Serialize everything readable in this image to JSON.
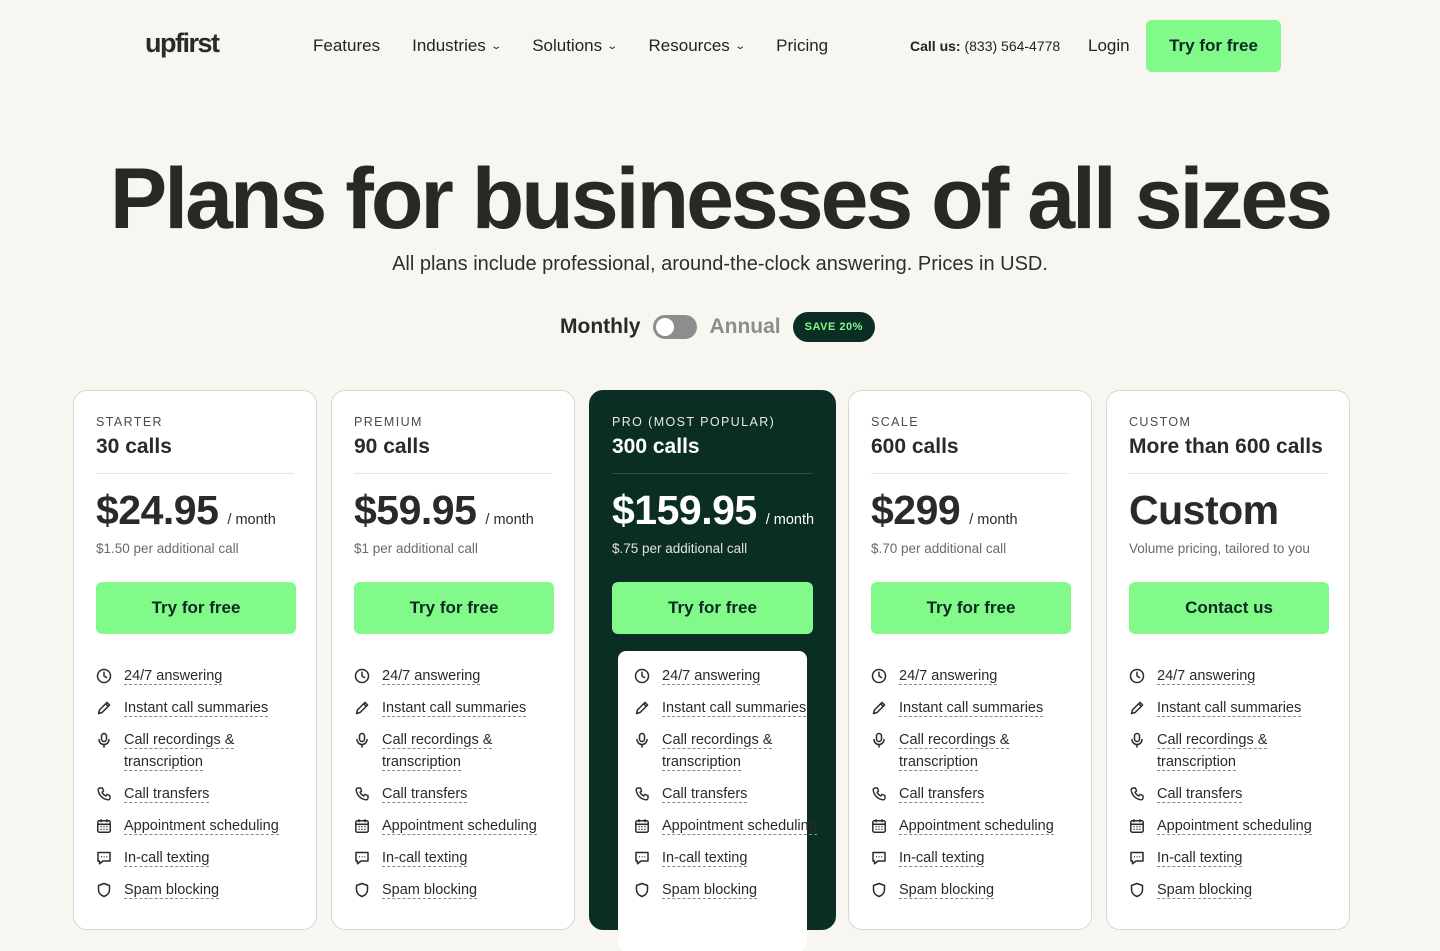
{
  "nav": {
    "logo": "upfirst",
    "menu": [
      {
        "label": "Features",
        "dropdown": false
      },
      {
        "label": "Industries",
        "dropdown": true
      },
      {
        "label": "Solutions",
        "dropdown": true
      },
      {
        "label": "Resources",
        "dropdown": true
      },
      {
        "label": "Pricing",
        "dropdown": false
      }
    ],
    "call_label": "Call us:",
    "phone": "(833) 564-4778",
    "login": "Login",
    "cta": "Try for free"
  },
  "hero": {
    "title": "Plans for businesses of all sizes",
    "subtitle": "All plans include professional, around-the-clock answering. Prices in USD."
  },
  "billing": {
    "monthly": "Monthly",
    "annual": "Annual",
    "badge": "SAVE 20%"
  },
  "colors": {
    "accent": "#82fa8a",
    "dark": "#0b2e24",
    "background": "#f7f6f1"
  },
  "features": [
    {
      "label": "24/7 answering",
      "icon": "clock-icon"
    },
    {
      "label": "Instant call summaries",
      "icon": "pencil-icon"
    },
    {
      "label": "Call recordings & transcription",
      "icon": "microphone-icon"
    },
    {
      "label": "Call transfers",
      "icon": "phone-icon"
    },
    {
      "label": "Appointment scheduling",
      "icon": "calendar-icon"
    },
    {
      "label": "In-call texting",
      "icon": "chat-icon"
    },
    {
      "label": "Spam blocking",
      "icon": "shield-icon"
    }
  ],
  "plans": [
    {
      "tier": "STARTER",
      "calls": "30 calls",
      "price": "$24.95",
      "per": "/ month",
      "extra": "$1.50 per additional call",
      "cta": "Try for free"
    },
    {
      "tier": "PREMIUM",
      "calls": "90 calls",
      "price": "$59.95",
      "per": "/ month",
      "extra": "$1 per additional call",
      "cta": "Try for free"
    },
    {
      "tier": "PRO (MOST POPULAR)",
      "calls": "300 calls",
      "price": "$159.95",
      "per": "/ month",
      "extra": "$.75 per additional call",
      "cta": "Try for free"
    },
    {
      "tier": "SCALE",
      "calls": "600 calls",
      "price": "$299",
      "per": "/ month",
      "extra": "$.70 per additional call",
      "cta": "Try for free"
    },
    {
      "tier": "CUSTOM",
      "calls": "More than 600 calls",
      "price": "Custom",
      "per": "",
      "extra": "Volume pricing, tailored to you",
      "cta": "Contact us"
    }
  ]
}
